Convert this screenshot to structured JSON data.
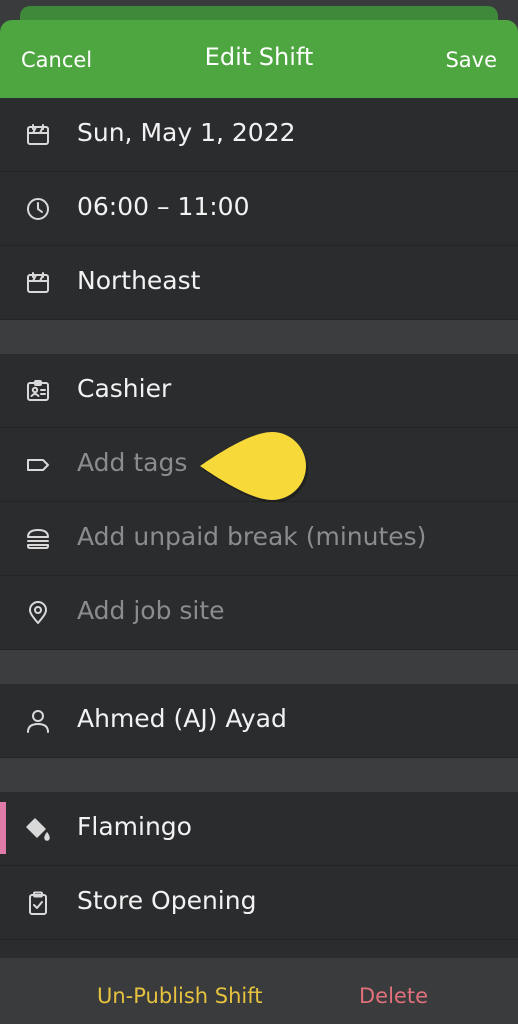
{
  "header": {
    "cancel_label": "Cancel",
    "title": "Edit Shift",
    "save_label": "Save",
    "color": "#4ea641"
  },
  "shift": {
    "date": "Sun, May 1, 2022",
    "time": "06:00 – 11:00",
    "schedule": "Northeast"
  },
  "details": {
    "position": "Cashier",
    "tags_placeholder": "Add tags",
    "break_placeholder": "Add unpaid break (minutes)",
    "job_site_placeholder": "Add job site"
  },
  "assignee": {
    "name": "Ahmed (AJ) Ayad"
  },
  "extras": {
    "color_name": "Flamingo",
    "color_hex": "#e07aa8",
    "task_list": "Store Opening"
  },
  "icons": {
    "date": "calendar-icon",
    "time": "clock-icon",
    "schedule": "calendar-icon",
    "position": "id-badge-icon",
    "tags": "tag-icon",
    "break": "burger-icon",
    "job_site": "location-pin-icon",
    "assignee": "person-icon",
    "color": "paint-bucket-icon",
    "task_list": "clipboard-check-icon"
  },
  "footer": {
    "unpublish_label": "Un-Publish Shift",
    "delete_label": "Delete",
    "unpublish_color": "#e6c23e",
    "delete_color": "#e0707a"
  },
  "annotation": {
    "callout_color": "#f7d93a"
  }
}
